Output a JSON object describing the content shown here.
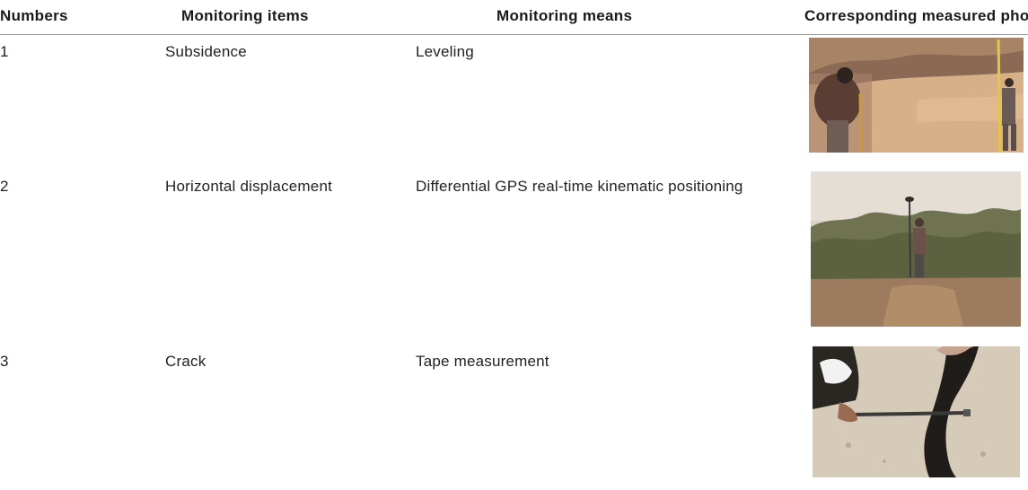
{
  "table": {
    "headers": {
      "number": "Numbers",
      "item": "Monitoring items",
      "means": "Monitoring means",
      "photo": "Corresponding measured photos"
    },
    "rows": [
      {
        "number": "1",
        "item": "Subsidence",
        "means": "Leveling",
        "photo": "leveling survey with rod and level in desert scrub"
      },
      {
        "number": "2",
        "item": "Horizontal displacement",
        "means": "Differential GPS real-time kinematic positioning",
        "photo": "person holding GPS antenna pole among shrubs"
      },
      {
        "number": "3",
        "item": "Crack",
        "means": "Tape measurement",
        "photo": "tape measure across a ground crack"
      }
    ]
  }
}
